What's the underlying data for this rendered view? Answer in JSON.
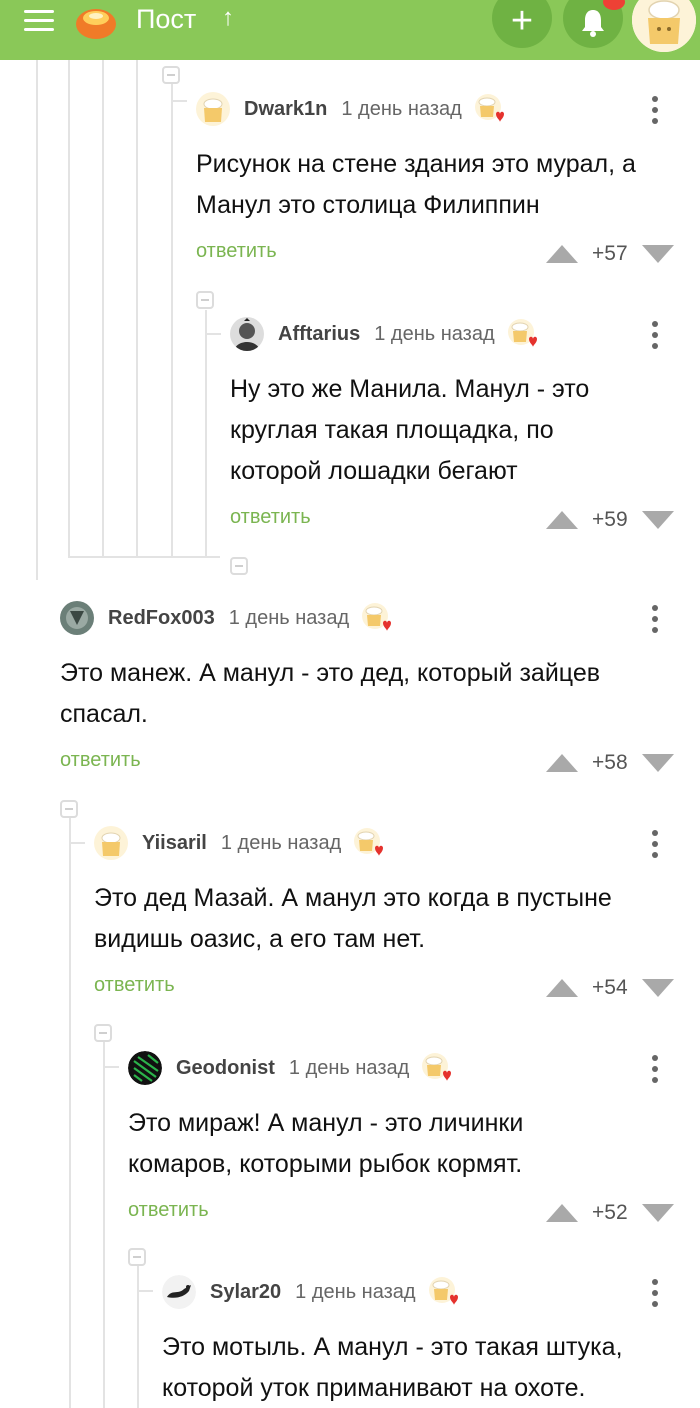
{
  "header": {
    "title": "Пост",
    "accent": "#8ac858",
    "icons": [
      "menu-icon",
      "logo-icon",
      "arrow-up-icon",
      "plus-icon",
      "bell-icon",
      "avatar-icon"
    ]
  },
  "comments": [
    {
      "user": "Dwark1n",
      "time": "1 день назад",
      "lines": [
        "Рисунок на стене здания это мурал, а",
        "Манул это столица Филиппин"
      ],
      "reply": "ответить",
      "score": "+57"
    },
    {
      "user": "Afftarius",
      "time": "1 день назад",
      "lines": [
        "Ну это же Манила. Манул - это",
        "круглая такая площадка, по",
        "которой лошадки бегают"
      ],
      "reply": "ответить",
      "score": "+59"
    },
    {
      "user": "RedFox003",
      "time": "1 день назад",
      "lines": [
        "Это манеж. А манул - это дед, который зайцев",
        "спасал."
      ],
      "reply": "ответить",
      "score": "+58"
    },
    {
      "user": "Yiisaril",
      "time": "1 день назад",
      "lines": [
        "Это дед Мазай. А манул это когда в пустыне",
        "видишь оазис, а его там нет."
      ],
      "reply": "ответить",
      "score": "+54"
    },
    {
      "user": "Geodonist",
      "time": "1 день назад",
      "lines": [
        "Это мираж! А манул - это личинки",
        "комаров, которыми рыбок кормят."
      ],
      "reply": "ответить",
      "score": "+52"
    },
    {
      "user": "Sylar20",
      "time": "1 день назад",
      "lines": [
        "Это мотыль. А манул - это такая штука,",
        "которой уток приманивают на охоте."
      ]
    }
  ]
}
